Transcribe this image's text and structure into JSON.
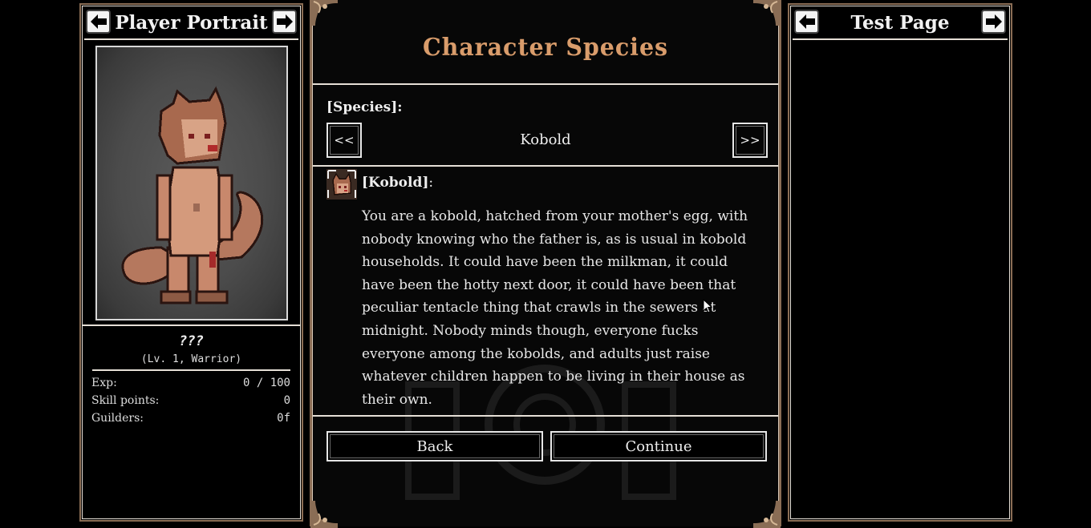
{
  "left_panel": {
    "title": "Player Portrait",
    "name": "???",
    "subtitle": "(Lv. 1, Warrior)",
    "stats": [
      {
        "label": "Exp:",
        "value": "0 / 100"
      },
      {
        "label": "Skill points:",
        "value": "0"
      },
      {
        "label": "Guilders:",
        "value": "0f"
      }
    ],
    "icons": {
      "prev": "arrow-left-icon",
      "next": "arrow-right-icon"
    }
  },
  "center_panel": {
    "title": "Character Species",
    "species_label": "[Species]:",
    "prev_label": "<<",
    "next_label": ">>",
    "selected_species": "Kobold",
    "description_heading": "[Kobold]",
    "description_heading_suffix": ":",
    "description": "You are a kobold, hatched from your mother's egg, with nobody knowing who the father is, as is usual in kobold households. It could have been the milkman, it could have been the hotty next door, it could have been that peculiar tentacle thing that crawls in the sewers at midnight. Nobody minds though, everyone fucks everyone among the kobolds, and adults just raise whatever children happen to be living in their house as their own.",
    "back_label": "Back",
    "continue_label": "Continue"
  },
  "right_panel": {
    "title": "Test Page"
  },
  "colors": {
    "title_accent": "#d99c6b",
    "frame_bronze": "#8a6d55",
    "border_light": "#e6dfd6",
    "background": "#000000"
  }
}
